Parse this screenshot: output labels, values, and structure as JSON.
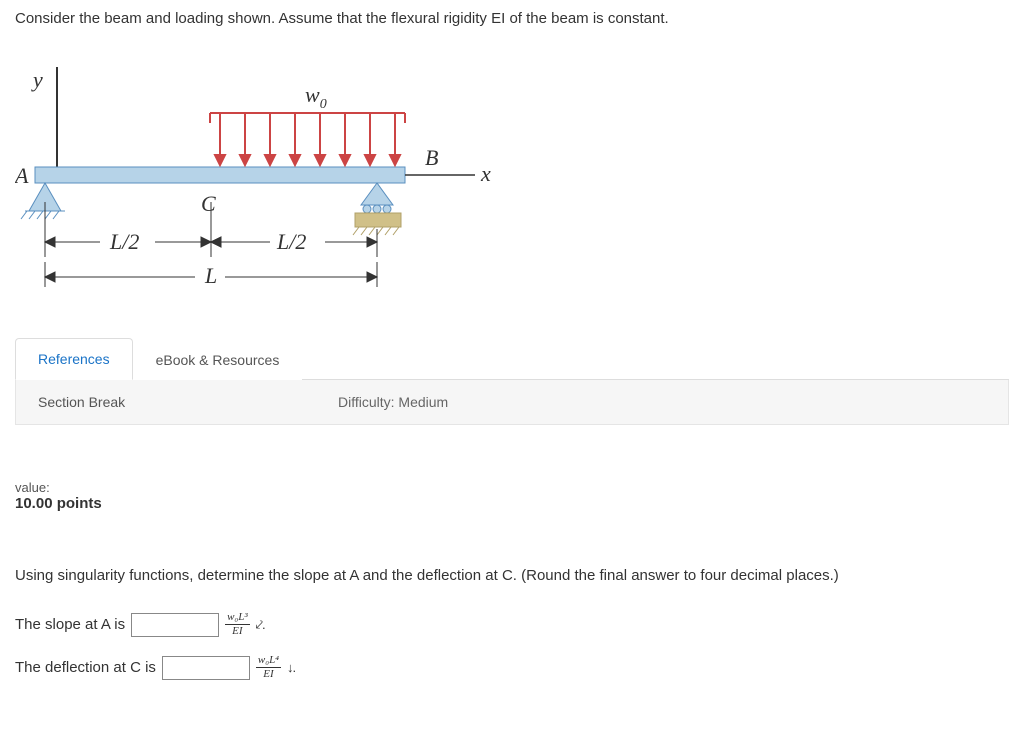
{
  "problem_statement": "Consider the beam and loading shown.  Assume that the flexural rigidity EI of the beam is constant.",
  "figure": {
    "y_label": "y",
    "x_label": "x",
    "w0_label": "w",
    "w0_sub": "0",
    "A_label": "A",
    "B_label": "B",
    "C_label": "C",
    "half_span_left": "L/2",
    "half_span_right": "L/2",
    "full_span": "L"
  },
  "tabs": {
    "references": "References",
    "ebook": "eBook & Resources"
  },
  "section_break": {
    "label": "Section Break",
    "difficulty": "Difficulty: Medium"
  },
  "value": {
    "label": "value:",
    "points": "10.00 points"
  },
  "question": "Using singularity functions, determine the slope at A and the deflection at C. (Round the final answer to four decimal places.)",
  "answers": {
    "slope_prefix": "The slope at A is",
    "slope_num": "w₀L³",
    "slope_den": "EI",
    "slope_arrow": "⤦.",
    "defl_prefix": "The deflection at C is",
    "defl_num": "w₀L⁴",
    "defl_den": "EI",
    "defl_arrow": "↓."
  }
}
